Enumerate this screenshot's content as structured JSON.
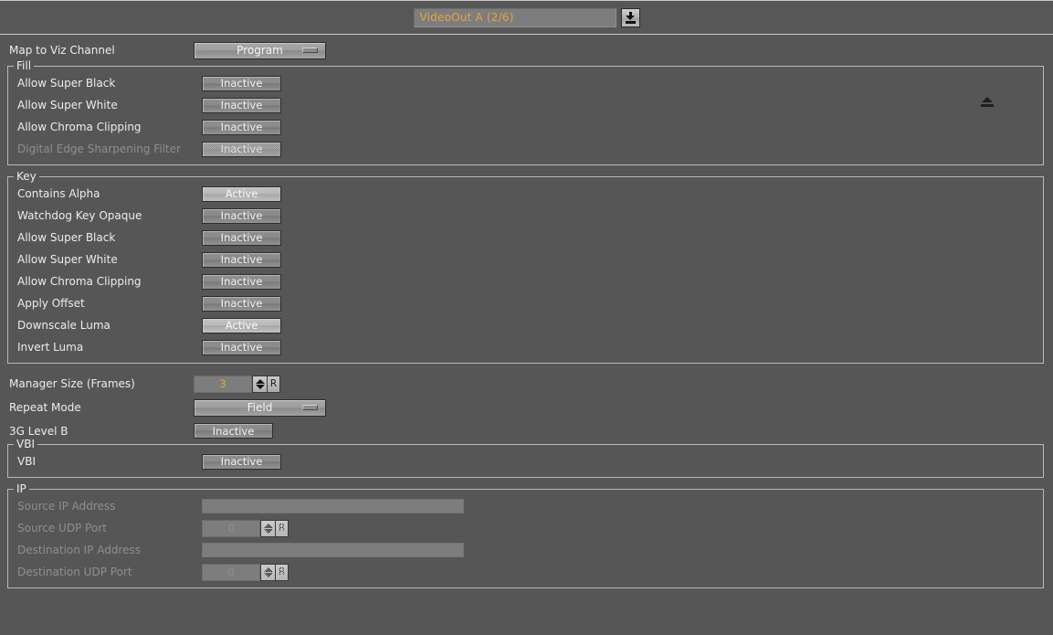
{
  "header": {
    "selector_value": "VideoOut A (2/6)",
    "selector_button_icon": "download-arrow-icon"
  },
  "top": {
    "map_label": "Map to Viz Channel",
    "map_value": "Program",
    "eject_icon": "eject-icon"
  },
  "groups": [
    {
      "id": "fill",
      "legend": "Fill",
      "rows": [
        {
          "label": "Allow Super Black",
          "value": "Inactive",
          "state": "off",
          "disabled": false
        },
        {
          "label": "Allow Super White",
          "value": "Inactive",
          "state": "off",
          "disabled": false
        },
        {
          "label": "Allow Chroma Clipping",
          "value": "Inactive",
          "state": "off",
          "disabled": false
        },
        {
          "label": "Digital Edge Sharpening Filter",
          "value": "Inactive",
          "state": "off",
          "disabled": true
        }
      ]
    },
    {
      "id": "key",
      "legend": "Key",
      "rows": [
        {
          "label": "Contains Alpha",
          "value": "Active",
          "state": "on",
          "disabled": false
        },
        {
          "label": "Watchdog Key Opaque",
          "value": "Inactive",
          "state": "off",
          "disabled": false
        },
        {
          "label": "Allow Super Black",
          "value": "Inactive",
          "state": "off",
          "disabled": false
        },
        {
          "label": "Allow Super White",
          "value": "Inactive",
          "state": "off",
          "disabled": false
        },
        {
          "label": "Allow Chroma Clipping",
          "value": "Inactive",
          "state": "off",
          "disabled": false
        },
        {
          "label": "Apply Offset",
          "value": "Inactive",
          "state": "off",
          "disabled": false
        },
        {
          "label": "Downscale Luma",
          "value": "Active",
          "state": "on",
          "disabled": false
        },
        {
          "label": "Invert Luma",
          "value": "Inactive",
          "state": "off",
          "disabled": false
        }
      ]
    }
  ],
  "middle": {
    "manager_size_label": "Manager Size (Frames)",
    "manager_size_value": "3",
    "reset_label": "R",
    "repeat_mode_label": "Repeat Mode",
    "repeat_mode_value": "Field",
    "level_b_label": "3G Level B",
    "level_b_value": "Inactive"
  },
  "vbi": {
    "legend": "VBI",
    "label": "VBI",
    "value": "Inactive"
  },
  "ip": {
    "legend": "IP",
    "source_ip_label": "Source IP Address",
    "source_ip_value": "",
    "source_port_label": "Source UDP Port",
    "source_port_value": "0",
    "dest_ip_label": "Destination IP Address",
    "dest_ip_value": "",
    "dest_port_label": "Destination UDP Port",
    "dest_port_value": "0",
    "reset_label": "R"
  },
  "colors": {
    "background": "#565656",
    "accent_text": "#e8a33d",
    "label_text": "#ececec",
    "disabled_text": "#8e8e8e",
    "field_bg": "#7d7d7d",
    "border": "#b9b9b9"
  }
}
